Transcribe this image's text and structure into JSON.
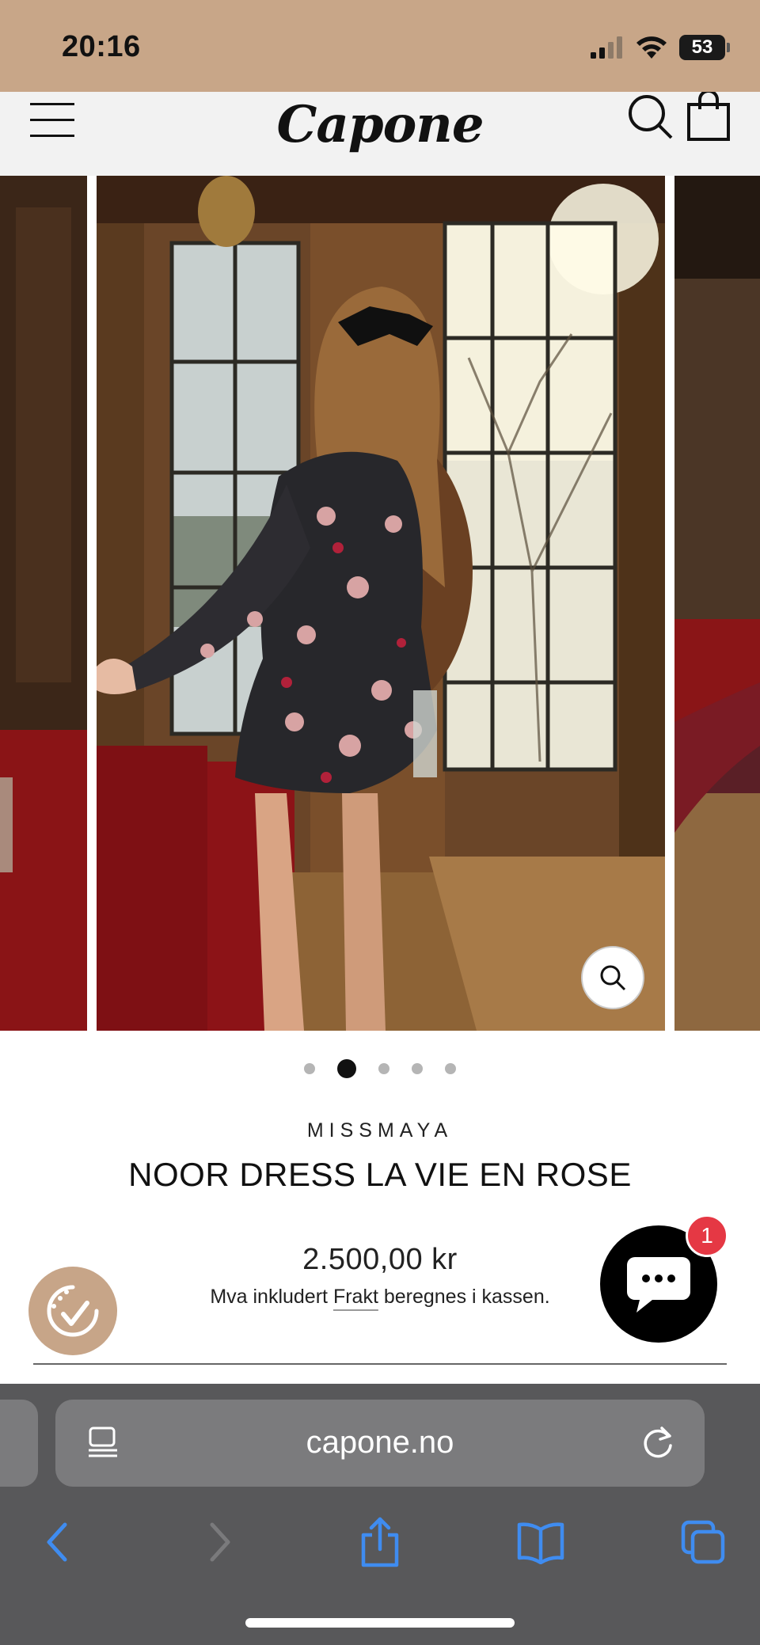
{
  "status_bar": {
    "time": "20:16",
    "battery": "53",
    "icons": [
      "cellular-signal-icon",
      "wifi-icon",
      "battery-icon"
    ]
  },
  "header": {
    "logo_text": "Capone",
    "icons": [
      "hamburger-menu-icon",
      "search-icon",
      "shopping-bag-icon"
    ]
  },
  "gallery": {
    "slide_count": 5,
    "active_slide": 2,
    "zoom_icon": "zoom-search-icon"
  },
  "product": {
    "brand": "MISSMAYA",
    "title": "NOOR DRESS LA VIE EN ROSE",
    "price": "2.500,00 kr",
    "tax_prefix": "Mva inkludert ",
    "shipping_link": "Frakt",
    "tax_suffix": " beregnes i kassen."
  },
  "widgets": {
    "chat_unread_count": "1",
    "chat_icon": "chat-bubble-icon",
    "badge_icon": "smile-check-icon"
  },
  "colors": {
    "status_bar": "#c8a688",
    "header_bg": "#f2f2f2",
    "badge": "#c7a588",
    "notification": "#e53844",
    "browser_bar": "#58585a",
    "browser_accent": "#3f8cf0"
  },
  "browser": {
    "url": "capone.no",
    "toolbar": [
      "back-icon",
      "forward-icon",
      "share-icon",
      "bookmarks-icon",
      "tabs-icon"
    ]
  }
}
